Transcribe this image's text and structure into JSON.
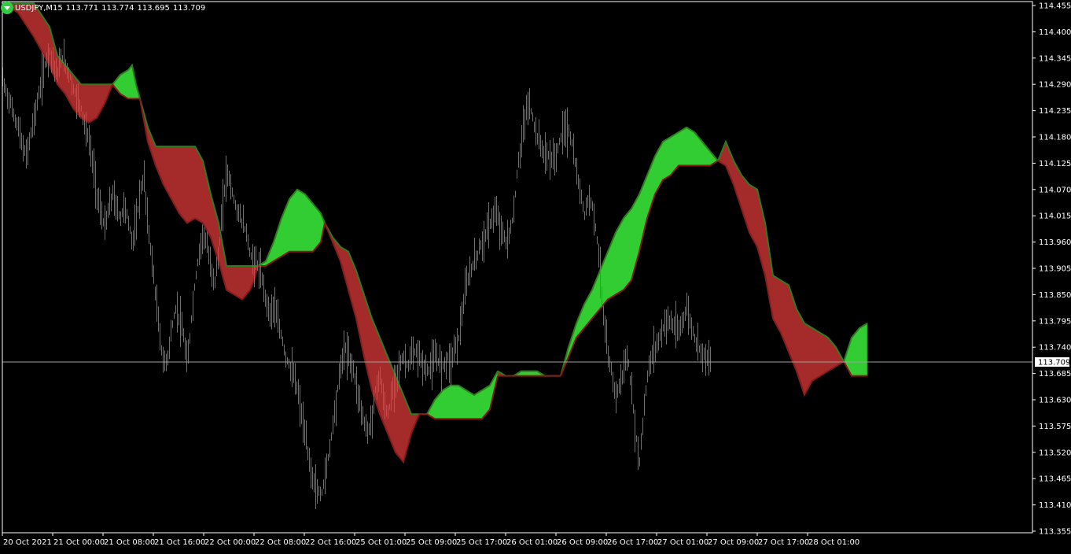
{
  "header": {
    "symbol": "USDJPY,M15",
    "open": "113.771",
    "high": "113.774",
    "low": "113.695",
    "close": "113.709",
    "icon": "triangle-down-icon"
  },
  "colors": {
    "background": "#000000",
    "bars": "#2e9e2e",
    "cloud_bull": "#32cd32",
    "cloud_bear": "#a52a2a",
    "text": "#ffffff",
    "current_price_line": "#a0a0a0"
  },
  "chart_data": {
    "type": "line",
    "price_axis": {
      "ylim": [
        113.355,
        114.455
      ],
      "ticks": [
        "114.455",
        "114.400",
        "114.345",
        "114.290",
        "114.235",
        "114.180",
        "114.125",
        "114.070",
        "114.015",
        "113.960",
        "113.905",
        "113.850",
        "113.795",
        "113.740",
        "113.685",
        "113.630",
        "113.575",
        "113.520",
        "113.465",
        "113.410",
        "113.355"
      ]
    },
    "current_price": "113.709",
    "time_axis_labels": [
      "20 Oct 2021",
      "21 Oct 00:00",
      "21 Oct 08:00",
      "21 Oct 16:00",
      "22 Oct 00:00",
      "22 Oct 08:00",
      "22 Oct 16:00",
      "25 Oct 01:00",
      "25 Oct 09:00",
      "25 Oct 17:00",
      "26 Oct 01:00",
      "26 Oct 09:00",
      "26 Oct 17:00",
      "27 Oct 01:00",
      "27 Oct 09:00",
      "27 Oct 17:00",
      "28 Oct 01:00"
    ],
    "price_line": {
      "x": [
        0,
        5,
        10,
        15,
        20,
        25,
        30,
        35,
        40,
        45,
        50,
        55,
        60,
        65,
        70,
        75,
        80,
        85,
        90,
        95,
        100,
        105,
        110,
        115,
        120,
        125,
        130,
        135,
        140,
        145,
        150,
        155,
        160,
        165,
        170,
        175,
        180,
        185,
        190,
        195,
        200,
        205,
        210,
        215,
        220,
        225,
        230,
        235,
        240,
        245,
        250,
        255,
        260,
        265,
        270,
        275,
        280,
        285,
        290,
        295,
        300,
        305,
        310,
        315,
        320,
        325,
        330,
        335,
        340,
        345,
        350,
        355,
        360,
        365,
        370,
        375,
        380,
        385,
        390,
        395,
        400,
        405,
        410,
        415,
        420,
        425,
        430,
        435,
        440,
        445,
        450,
        455,
        460,
        465,
        470,
        475,
        480,
        485,
        490,
        495,
        500,
        505,
        510,
        515,
        520,
        525,
        530,
        535,
        540,
        545,
        550,
        555,
        560,
        565,
        570,
        575,
        580,
        585,
        590,
        595,
        600,
        605,
        610,
        615,
        620,
        625,
        630,
        635,
        640,
        645,
        650,
        655,
        660,
        665,
        670,
        675,
        680,
        685,
        690,
        695,
        700,
        705,
        710,
        715,
        720,
        725,
        730,
        735,
        740,
        745,
        750,
        755,
        760,
        765,
        770,
        775,
        780,
        785,
        790,
        795,
        800,
        805,
        810,
        815,
        820,
        825,
        830,
        835,
        840,
        845,
        850,
        855,
        860,
        865,
        870,
        875,
        880,
        885,
        890,
        895,
        900,
        905,
        910,
        915,
        920,
        925,
        930,
        935,
        940,
        945,
        950,
        955,
        960,
        965,
        970,
        975,
        980,
        985,
        990,
        995,
        1000,
        1005,
        1010,
        1015,
        1020,
        1025,
        1030,
        1035,
        1040,
        1045,
        1050
      ],
      "y": [
        114.3,
        114.27,
        114.25,
        114.22,
        114.2,
        114.16,
        114.14,
        114.18,
        114.22,
        114.26,
        114.3,
        114.34,
        114.36,
        114.33,
        114.31,
        114.35,
        114.33,
        114.31,
        114.28,
        114.26,
        114.24,
        114.2,
        114.17,
        114.12,
        114.06,
        114.02,
        113.99,
        114.03,
        114.06,
        114.03,
        114.01,
        114.04,
        114.0,
        113.96,
        114.0,
        114.07,
        114.09,
        113.99,
        113.92,
        113.84,
        113.76,
        113.7,
        113.72,
        113.78,
        113.82,
        113.8,
        113.76,
        113.7,
        113.8,
        113.88,
        113.94,
        113.98,
        113.95,
        113.9,
        113.88,
        113.94,
        114.04,
        114.11,
        114.08,
        114.04,
        114.02,
        114.0,
        113.98,
        113.93,
        113.92,
        113.91,
        113.88,
        113.84,
        113.81,
        113.83,
        113.79,
        113.76,
        113.72,
        113.7,
        113.68,
        113.65,
        113.6,
        113.55,
        113.5,
        113.46,
        113.44,
        113.43,
        113.47,
        113.52,
        113.58,
        113.64,
        113.7,
        113.74,
        113.72,
        113.7,
        113.66,
        113.62,
        113.58,
        113.56,
        113.6,
        113.66,
        113.68,
        113.62,
        113.6,
        113.64,
        113.68,
        113.7,
        113.72,
        113.7,
        113.72,
        113.73,
        113.72,
        113.7,
        113.69,
        113.7,
        113.72,
        113.71,
        113.7,
        113.72,
        113.71,
        113.74,
        113.76,
        113.82,
        113.87,
        113.9,
        113.92,
        113.94,
        113.96,
        113.98,
        114.0,
        114.02,
        114.01,
        113.98,
        113.96,
        113.98,
        114.02,
        114.12,
        114.17,
        114.23,
        114.25,
        114.21,
        114.18,
        114.16,
        114.14,
        114.14,
        114.13,
        114.15,
        114.18,
        114.2,
        114.19,
        114.16,
        114.1,
        114.06,
        114.02,
        114.05,
        114.04,
        113.98,
        113.9,
        113.78,
        113.72,
        113.68,
        113.64,
        113.66,
        113.7,
        113.72,
        113.64,
        113.56,
        113.5,
        113.6,
        113.68,
        113.72,
        113.74,
        113.76,
        113.78,
        113.8,
        113.79,
        113.78,
        113.77,
        113.8,
        113.82,
        113.79,
        113.76,
        113.74,
        113.73,
        113.72,
        113.71
      ]
    },
    "cloud_segments": [
      {
        "trend": "bear",
        "x": [
          0,
          20,
          40,
          60,
          70,
          80,
          90,
          100,
          110,
          120,
          130,
          140
        ],
        "upper": [
          114.46,
          114.46,
          114.46,
          114.41,
          114.35,
          114.33,
          114.31,
          114.29,
          114.29,
          114.29,
          114.29,
          114.29
        ],
        "lower": [
          114.46,
          114.44,
          114.39,
          114.33,
          114.29,
          114.27,
          114.24,
          114.22,
          114.21,
          114.22,
          114.25,
          114.29
        ]
      },
      {
        "trend": "bull",
        "x": [
          140,
          150,
          160,
          165,
          170,
          175
        ],
        "upper": [
          114.29,
          114.31,
          114.32,
          114.33,
          114.29,
          114.26
        ],
        "lower": [
          114.29,
          114.27,
          114.26,
          114.26,
          114.26,
          114.26
        ]
      },
      {
        "trend": "bear",
        "x": [
          175,
          185,
          195,
          205,
          215,
          225,
          235,
          245,
          255,
          265,
          275,
          285,
          295,
          305,
          315,
          320,
          325
        ],
        "upper": [
          114.26,
          114.2,
          114.16,
          114.16,
          114.16,
          114.16,
          114.16,
          114.16,
          114.13,
          114.06,
          114.0,
          113.91,
          113.91,
          113.91,
          113.91,
          113.91,
          113.91
        ],
        "lower": [
          114.26,
          114.17,
          114.12,
          114.08,
          114.05,
          114.02,
          114.0,
          114.01,
          114.0,
          113.97,
          113.92,
          113.86,
          113.85,
          113.84,
          113.86,
          113.88,
          113.91
        ]
      },
      {
        "trend": "bull",
        "x": [
          325,
          335,
          345,
          355,
          365,
          375,
          385,
          395,
          405,
          410
        ],
        "upper": [
          113.91,
          113.92,
          113.96,
          114.01,
          114.05,
          114.07,
          114.06,
          114.04,
          114.02,
          114.0
        ],
        "lower": [
          113.91,
          113.91,
          113.92,
          113.93,
          113.94,
          113.94,
          113.94,
          113.94,
          113.96,
          114.0
        ]
      },
      {
        "trend": "bear",
        "x": [
          410,
          420,
          430,
          440,
          450,
          460,
          470,
          480,
          490,
          500,
          510,
          520,
          530,
          540
        ],
        "upper": [
          114.0,
          113.97,
          113.95,
          113.94,
          113.9,
          113.85,
          113.8,
          113.76,
          113.72,
          113.68,
          113.64,
          113.6,
          113.6,
          113.6
        ],
        "lower": [
          114.0,
          113.96,
          113.92,
          113.86,
          113.8,
          113.72,
          113.65,
          113.6,
          113.56,
          113.52,
          113.5,
          113.56,
          113.6,
          113.6
        ]
      },
      {
        "trend": "bull",
        "x": [
          540,
          550,
          560,
          570,
          580,
          590,
          600,
          610,
          620,
          630
        ],
        "upper": [
          113.6,
          113.63,
          113.65,
          113.66,
          113.66,
          113.65,
          113.64,
          113.65,
          113.66,
          113.69
        ],
        "lower": [
          113.6,
          113.59,
          113.59,
          113.59,
          113.59,
          113.59,
          113.59,
          113.59,
          113.61,
          113.68
        ]
      },
      {
        "trend": "bear",
        "x": [
          630,
          640,
          650
        ],
        "upper": [
          113.69,
          113.68,
          113.68
        ],
        "lower": [
          113.68,
          113.68,
          113.68
        ]
      },
      {
        "trend": "bull",
        "x": [
          650,
          660,
          670,
          680,
          690,
          700,
          710
        ],
        "upper": [
          113.68,
          113.69,
          113.69,
          113.69,
          113.68,
          113.68,
          113.68
        ],
        "lower": [
          113.68,
          113.68,
          113.68,
          113.68,
          113.68,
          113.68,
          113.68
        ]
      },
      {
        "trend": "bull",
        "x": [
          710,
          720,
          730,
          740,
          750,
          760,
          770,
          780,
          790,
          800,
          810,
          820,
          830,
          840,
          850,
          860,
          870,
          880,
          890,
          900,
          910
        ],
        "upper": [
          113.68,
          113.74,
          113.79,
          113.83,
          113.86,
          113.9,
          113.94,
          113.98,
          114.01,
          114.03,
          114.06,
          114.1,
          114.14,
          114.17,
          114.18,
          114.19,
          114.2,
          114.19,
          114.17,
          114.15,
          114.13
        ],
        "lower": [
          113.68,
          113.72,
          113.76,
          113.78,
          113.8,
          113.82,
          113.84,
          113.85,
          113.86,
          113.88,
          113.94,
          114.01,
          114.06,
          114.09,
          114.1,
          114.12,
          114.12,
          114.12,
          114.12,
          114.12,
          114.13
        ]
      },
      {
        "trend": "bear",
        "x": [
          910,
          920,
          930,
          940,
          950,
          960,
          970,
          980,
          990,
          1000,
          1010,
          1020,
          1030,
          1040,
          1050,
          1060,
          1070
        ],
        "upper": [
          114.13,
          114.17,
          114.13,
          114.1,
          114.08,
          114.07,
          114.0,
          113.89,
          113.88,
          113.87,
          113.82,
          113.79,
          113.78,
          113.77,
          113.76,
          113.74,
          113.71
        ],
        "lower": [
          114.13,
          114.12,
          114.08,
          114.03,
          113.98,
          113.95,
          113.89,
          113.8,
          113.77,
          113.73,
          113.69,
          113.64,
          113.67,
          113.68,
          113.69,
          113.7,
          113.71
        ]
      },
      {
        "trend": "bull",
        "x": [
          1070,
          1080,
          1090,
          1100
        ],
        "upper": [
          113.71,
          113.76,
          113.78,
          113.79
        ],
        "lower": [
          113.71,
          113.68,
          113.68,
          113.68
        ]
      }
    ]
  }
}
